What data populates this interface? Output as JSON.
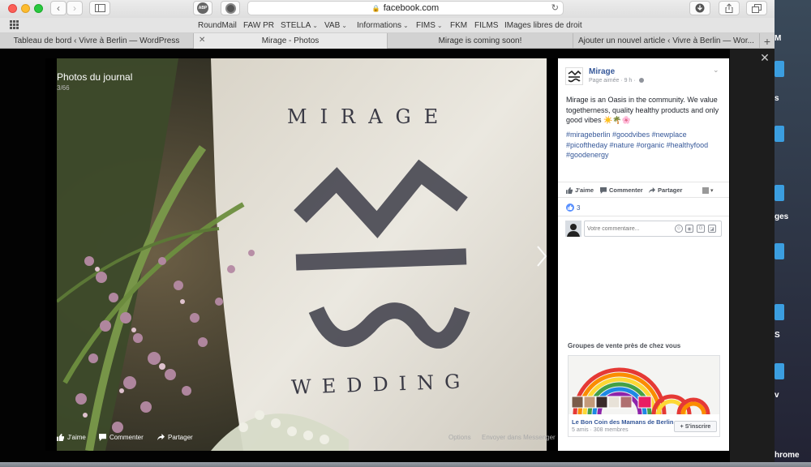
{
  "browser": {
    "url": "facebook.com",
    "bookmarks": [
      {
        "label": "RoundMail",
        "caret": false
      },
      {
        "label": "FAW PR",
        "caret": false
      },
      {
        "label": "STELLA",
        "caret": true
      },
      {
        "label": "VAB",
        "caret": true
      },
      {
        "label": "Informations",
        "caret": true
      },
      {
        "label": "FIMS",
        "caret": true
      },
      {
        "label": "FKM",
        "caret": false
      },
      {
        "label": "FILMS",
        "caret": false
      },
      {
        "label": "IMages libres de droit",
        "caret": false
      }
    ],
    "tabs": [
      {
        "label": "Tableau de bord ‹ Vivre à Berlin — WordPress",
        "active": false
      },
      {
        "label": "Mirage - Photos",
        "active": true
      },
      {
        "label": "Mirage is coming soon!",
        "active": false
      },
      {
        "label": "Ajouter un nouvel article ‹ Vivre à Berlin — Wor...",
        "active": false
      }
    ],
    "adblock_label": "ABP"
  },
  "desktop": {
    "labels": [
      "M",
      "s",
      "ges",
      "S",
      "v",
      "hrome"
    ]
  },
  "photo": {
    "album_title": "Photos du journal",
    "counter": "3/66",
    "sign_top_text": "MIRAGE",
    "sign_bottom_text": "WEDDING",
    "actions": {
      "like": "J'aime",
      "comment": "Commenter",
      "share": "Partager",
      "options": "Options",
      "send": "Envoyer dans Messenger"
    }
  },
  "post": {
    "page_name": "Mirage",
    "meta": "Page aimée · 9 h ·",
    "text": "Mirage is an Oasis in the community. We value togetherness, quality healthy products and only good vibes ☀️🌴🌸",
    "hashtags": "#mirageberlin #goodvibes #newplace #picoftheday #nature #organic #healthyfood #goodenergy",
    "actions": {
      "like": "J'aime",
      "comment": "Commenter",
      "share": "Partager"
    },
    "like_count": "3",
    "comment_placeholder": "Votre commentaire..."
  },
  "suggestions": {
    "title": "Groupes de vente près de chez vous",
    "group_name": "Le Bon Coin des Mamans de Berlin",
    "group_meta": "5 amis · 308 membres",
    "join_label": "+ S'inscrire"
  },
  "colors": {
    "fb_link": "#365899",
    "like_blue": "#5890ff",
    "overlay": "#000000"
  }
}
